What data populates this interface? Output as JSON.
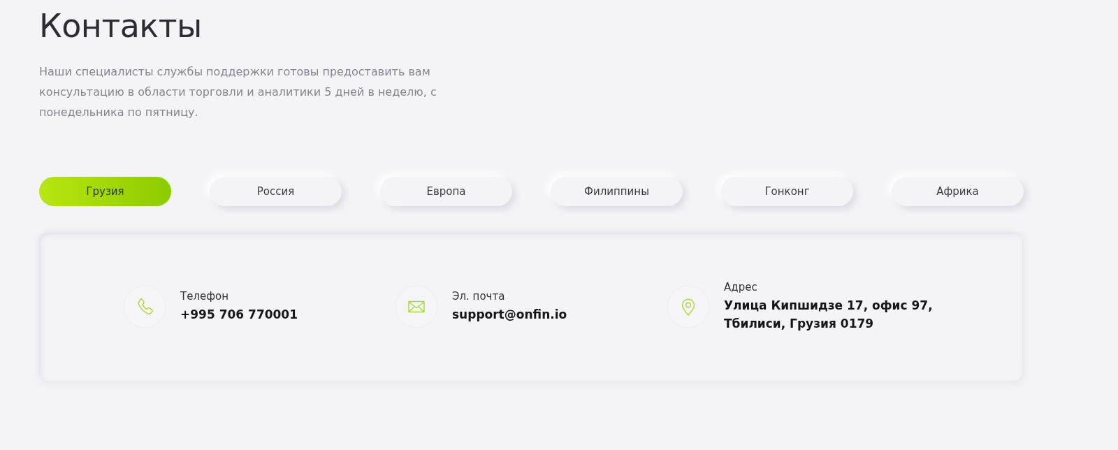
{
  "page": {
    "title": "Контакты",
    "description": "Наши специалисты службы поддержки готовы предоставить вам консультацию в области торговли и аналитики 5 дней в неделю, с понедельника по пятницу."
  },
  "tabs": [
    {
      "label": "Грузия",
      "selected": true
    },
    {
      "label": "Россия",
      "selected": false
    },
    {
      "label": "Европа",
      "selected": false
    },
    {
      "label": "Филиппины",
      "selected": false
    },
    {
      "label": "Гонконг",
      "selected": false
    },
    {
      "label": "Африка",
      "selected": false
    }
  ],
  "contacts": [
    {
      "kind": "phone",
      "label": "Телефон",
      "value": "+995 706 770001"
    },
    {
      "kind": "email",
      "label": "Эл. почта",
      "value": "support@onfin.io"
    },
    {
      "kind": "address",
      "label": "Адрес",
      "value": "Улица Кипшидзе 17, офис 97, Тбилиси, Грузия 0179"
    }
  ]
}
